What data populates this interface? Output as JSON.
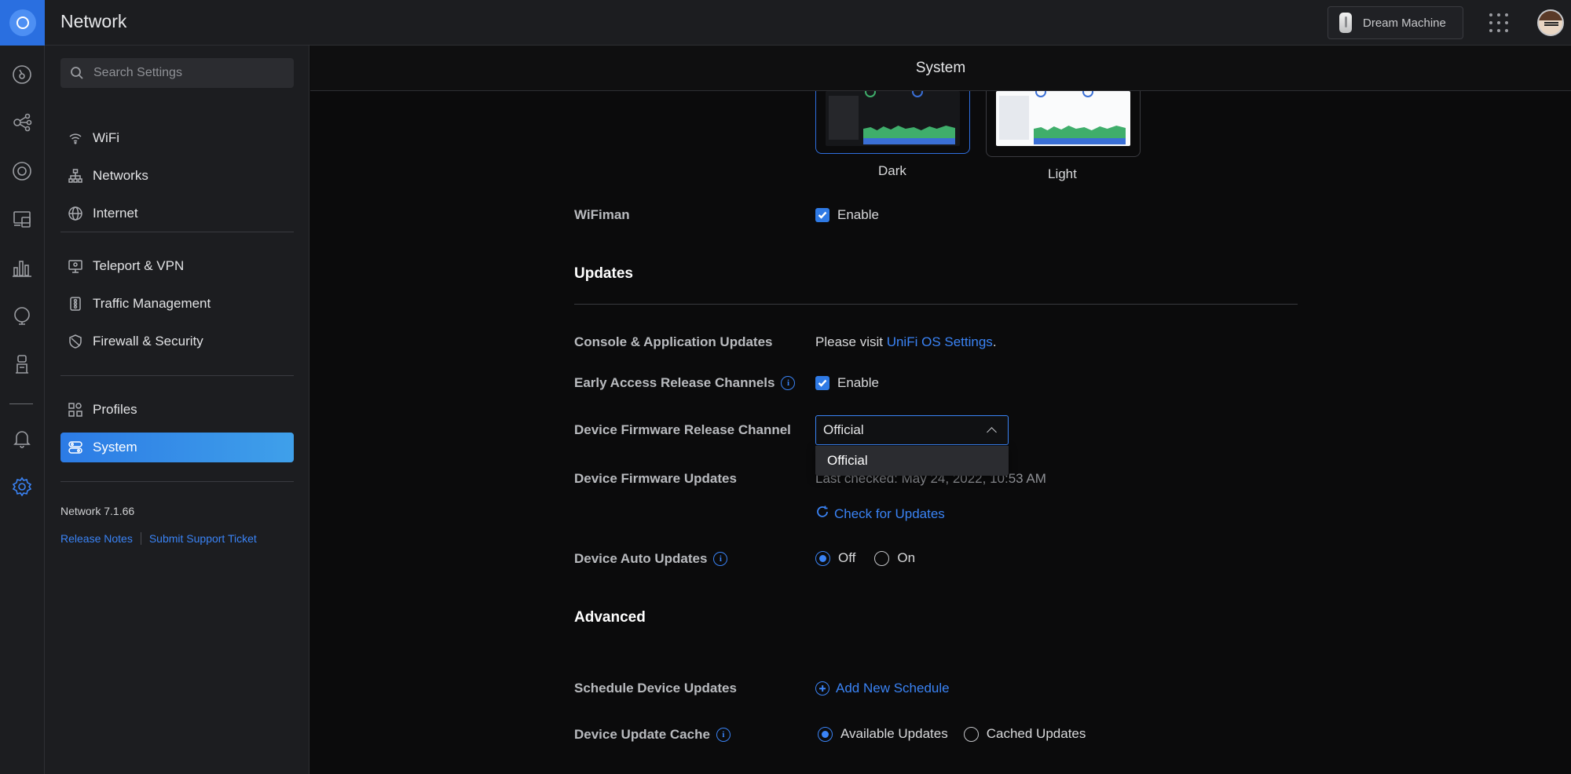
{
  "app": {
    "title": "Network"
  },
  "topbar": {
    "device_label": "Dream Machine"
  },
  "search": {
    "placeholder": "Search Settings"
  },
  "sidebar": {
    "items": [
      {
        "label": "WiFi",
        "icon": "wifi-icon"
      },
      {
        "label": "Networks",
        "icon": "network-tree-icon"
      },
      {
        "label": "Internet",
        "icon": "globe-icon"
      },
      {
        "label": "Teleport & VPN",
        "icon": "vpn-icon"
      },
      {
        "label": "Traffic Management",
        "icon": "traffic-icon"
      },
      {
        "label": "Firewall & Security",
        "icon": "shield-icon"
      },
      {
        "label": "Profiles",
        "icon": "profiles-icon"
      },
      {
        "label": "System",
        "icon": "system-icon",
        "active": true
      }
    ],
    "version": "Network 7.1.66",
    "release_notes": "Release Notes",
    "support_ticket": "Submit Support Ticket"
  },
  "main": {
    "header": "System",
    "theme": {
      "dark_label": "Dark",
      "light_label": "Light",
      "selected": "Dark"
    },
    "wifiman": {
      "label": "WiFiman",
      "option": "Enable",
      "checked": true
    },
    "updates": {
      "title": "Updates",
      "console": {
        "label": "Console & Application Updates",
        "text_prefix": "Please visit ",
        "link": "UniFi OS Settings",
        "text_suffix": "."
      },
      "early_access": {
        "label": "Early Access Release Channels",
        "option": "Enable",
        "checked": true
      },
      "firmware_channel": {
        "label": "Device Firmware Release Channel",
        "value": "Official",
        "options": [
          "Official"
        ]
      },
      "firmware_updates": {
        "label": "Device Firmware Updates",
        "last_checked": "Last checked: May 24, 2022, 10:53 AM",
        "check_button": "Check for Updates"
      },
      "auto_updates": {
        "label": "Device Auto Updates",
        "options": [
          "Off",
          "On"
        ],
        "selected": "Off"
      }
    },
    "advanced": {
      "title": "Advanced",
      "schedule": {
        "label": "Schedule Device Updates",
        "button": "Add New Schedule"
      },
      "cache": {
        "label": "Device Update Cache",
        "options": [
          "Available Updates",
          "Cached Updates"
        ],
        "selected": "Available Updates"
      }
    }
  },
  "colors": {
    "accent": "#3a83f5",
    "active_nav": "#2c7be5",
    "background": "#0b0b0c",
    "panel": "#1c1d20"
  }
}
